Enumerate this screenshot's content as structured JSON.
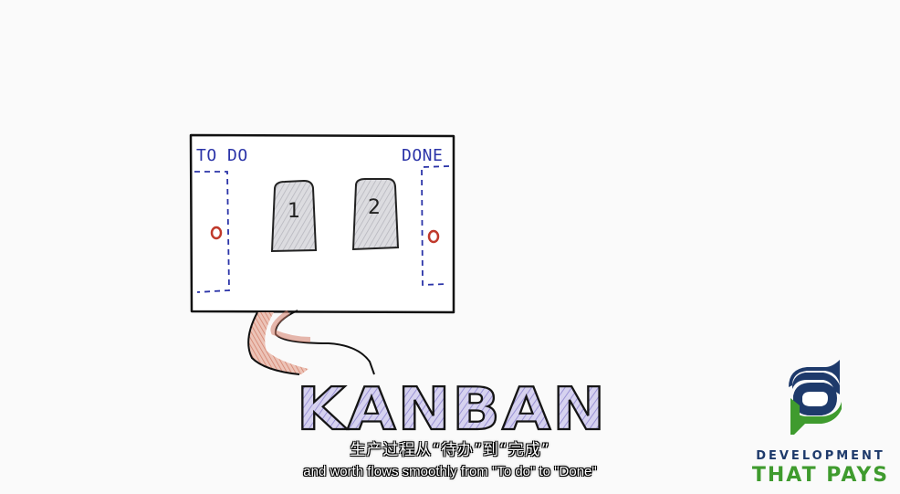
{
  "board": {
    "todo_label": "TO DO",
    "done_label": "DONE",
    "cards": [
      "1",
      "2"
    ]
  },
  "title": {
    "text": "KANBAN"
  },
  "subtitles": {
    "chinese": "生产过程从“待办”到“完成”",
    "english": "and worth flows smoothly from \"To do\" to \"Done\""
  },
  "logo": {
    "line1": "DEVELOPMENT",
    "line2": "THAT PAYS",
    "icon": "development-that-pays-logo-icon"
  },
  "colors": {
    "background": "#fafafa",
    "column_label": "#2b34a8",
    "dashed_lane": "#2b34a8",
    "token": "#c0392b",
    "card_fill": "#d3d3d8",
    "kanban_fill": "#c9c4ec",
    "pipe": "#d98c7a",
    "logo_blue": "#1e3a6b",
    "logo_green": "#3f9b2e"
  }
}
